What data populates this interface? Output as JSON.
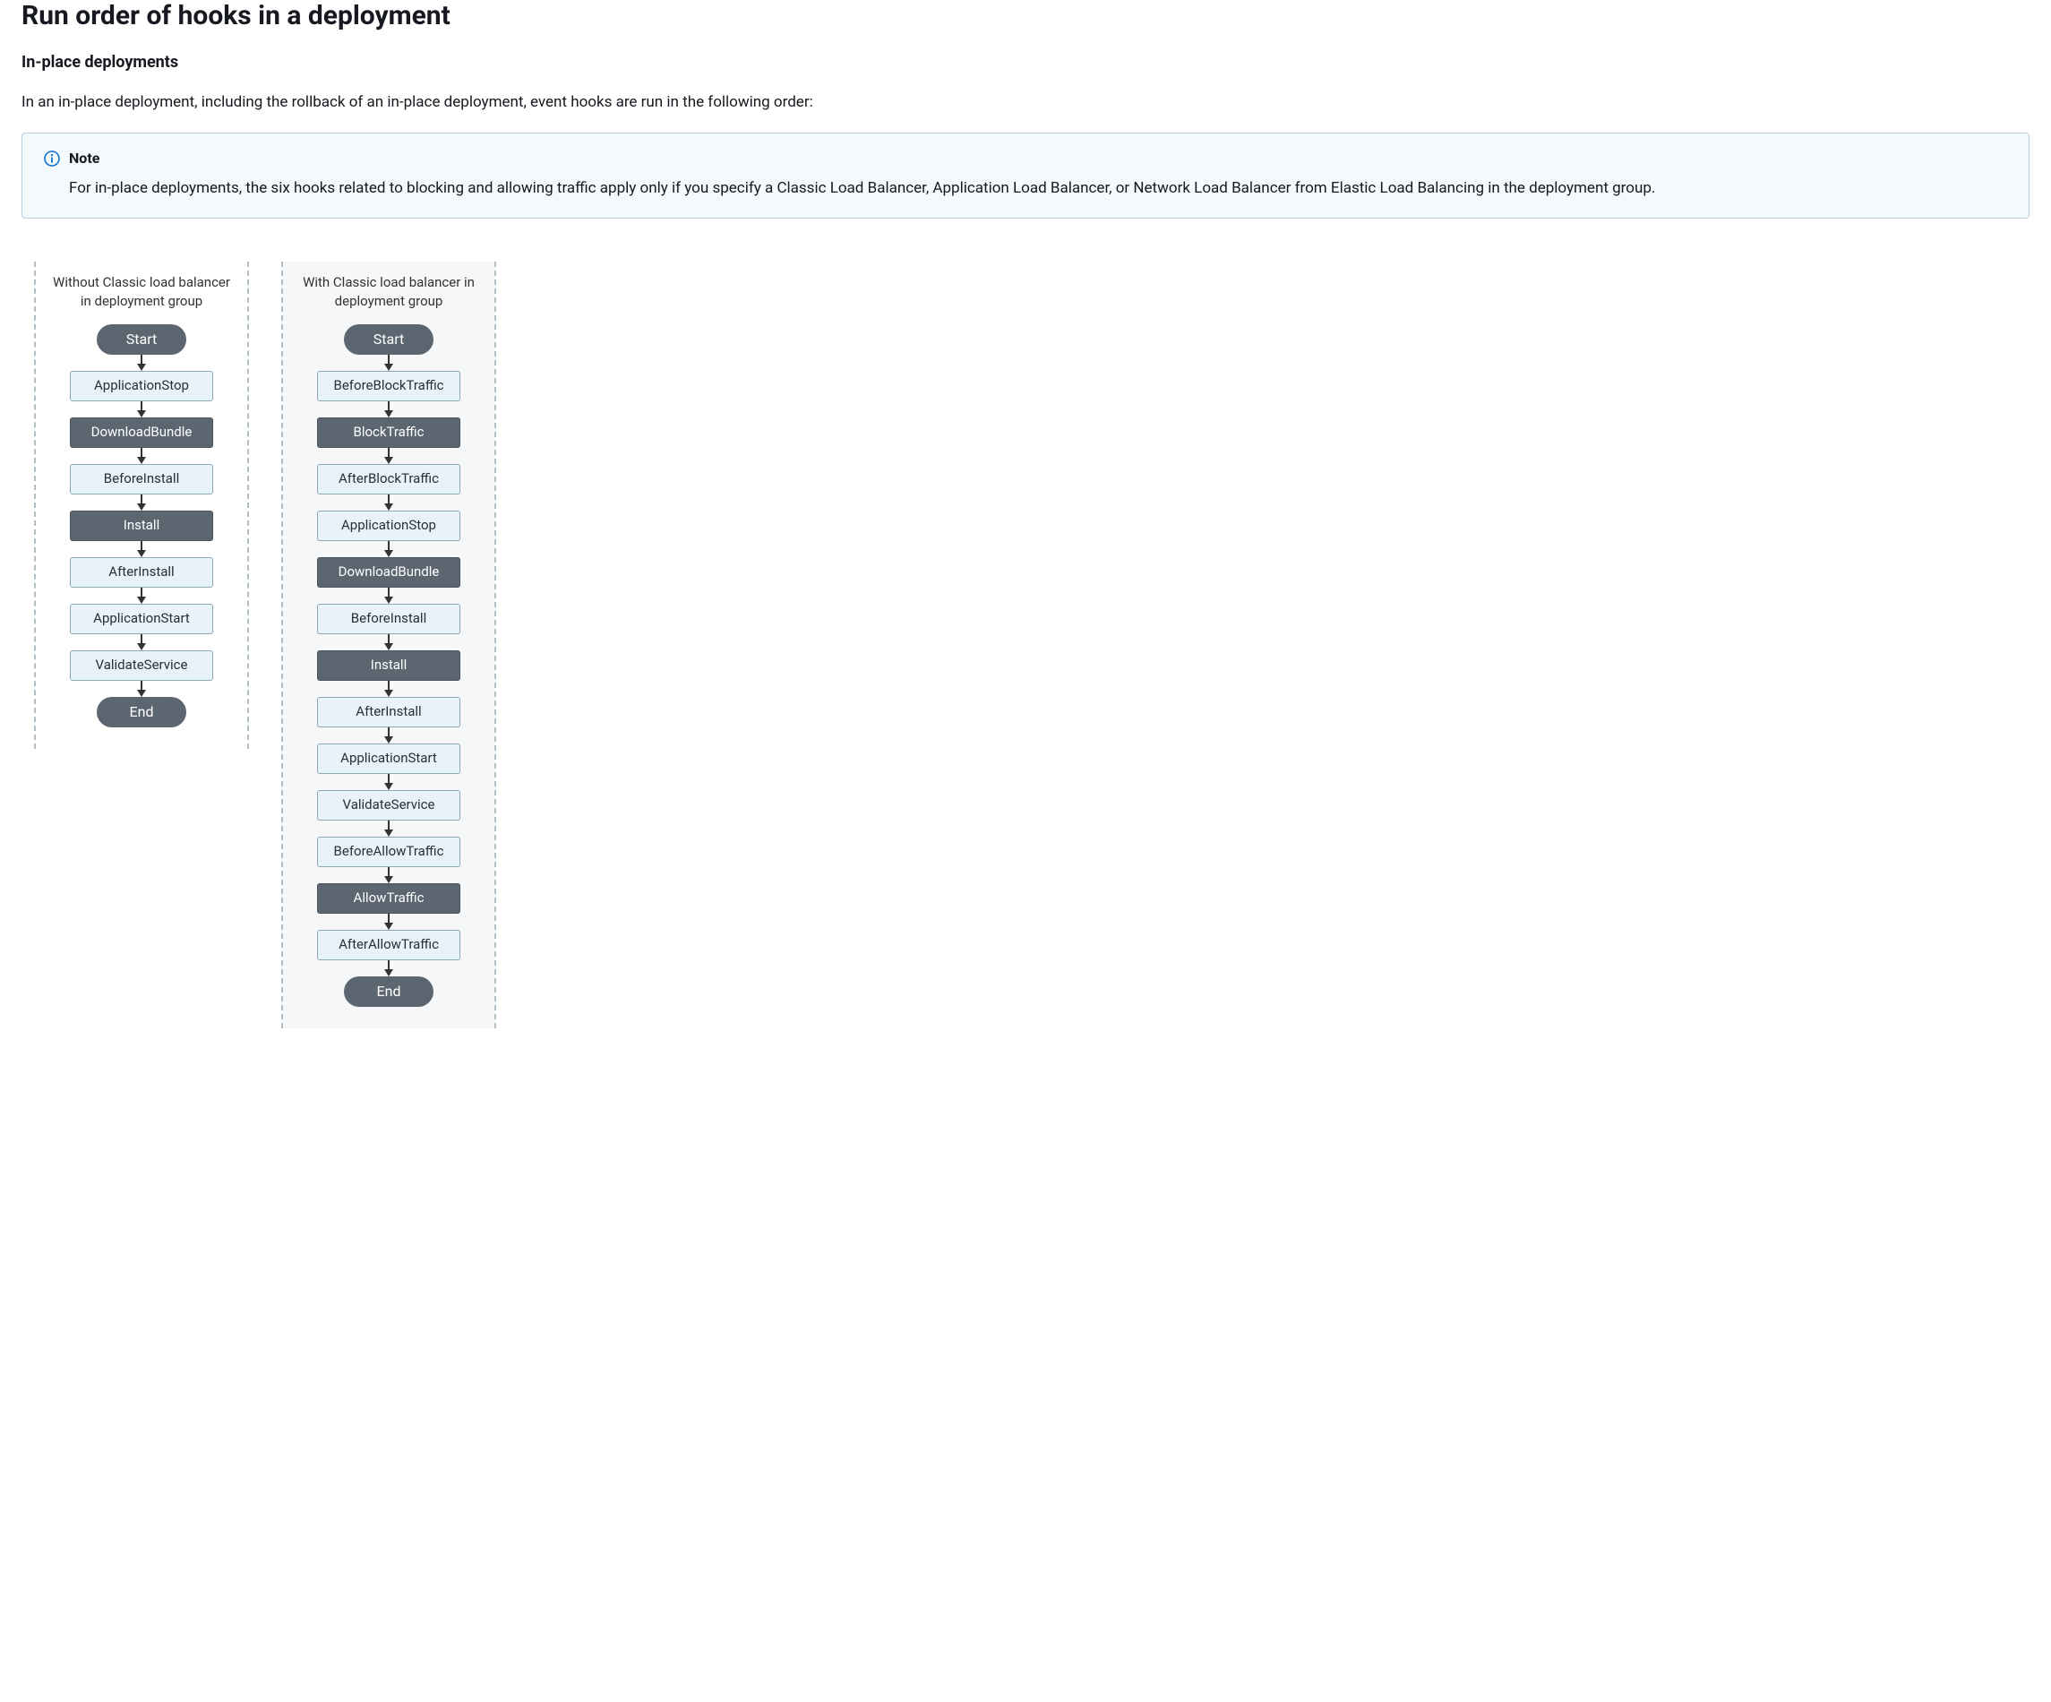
{
  "title": "Run order of hooks in a deployment",
  "subtitle": "In-place deployments",
  "intro_text": "In an in-place deployment, including the rollback of an in-place deployment, event hooks are run in the following order:",
  "note": {
    "label": "Note",
    "body": "For in-place deployments, the six hooks related to blocking and allowing traffic apply only if you specify a Classic Load Balancer, Application Load Balancer, or Network Load Balancer from Elastic Load Balancing in the deployment group."
  },
  "chart_data": {
    "type": "flow",
    "columns": [
      {
        "id": "without-lb",
        "header": "Without Classic load balancer in deployment group",
        "steps": [
          {
            "label": "Start",
            "style": "pill"
          },
          {
            "label": "ApplicationStop",
            "style": "light"
          },
          {
            "label": "DownloadBundle",
            "style": "dark"
          },
          {
            "label": "BeforeInstall",
            "style": "light"
          },
          {
            "label": "Install",
            "style": "dark"
          },
          {
            "label": "AfterInstall",
            "style": "light"
          },
          {
            "label": "ApplicationStart",
            "style": "light"
          },
          {
            "label": "ValidateService",
            "style": "light"
          },
          {
            "label": "End",
            "style": "pill"
          }
        ]
      },
      {
        "id": "with-lb",
        "header": "With Classic load balancer in deployment group",
        "steps": [
          {
            "label": "Start",
            "style": "pill"
          },
          {
            "label": "BeforeBlockTraffic",
            "style": "light"
          },
          {
            "label": "BlockTraffic",
            "style": "dark"
          },
          {
            "label": "AfterBlockTraffic",
            "style": "light"
          },
          {
            "label": "ApplicationStop",
            "style": "light"
          },
          {
            "label": "DownloadBundle",
            "style": "dark"
          },
          {
            "label": "BeforeInstall",
            "style": "light"
          },
          {
            "label": "Install",
            "style": "dark"
          },
          {
            "label": "AfterInstall",
            "style": "light"
          },
          {
            "label": "ApplicationStart",
            "style": "light"
          },
          {
            "label": "ValidateService",
            "style": "light"
          },
          {
            "label": "BeforeAllowTraffic",
            "style": "light"
          },
          {
            "label": "AllowTraffic",
            "style": "dark"
          },
          {
            "label": "AfterAllowTraffic",
            "style": "light"
          },
          {
            "label": "End",
            "style": "pill"
          }
        ]
      }
    ]
  }
}
